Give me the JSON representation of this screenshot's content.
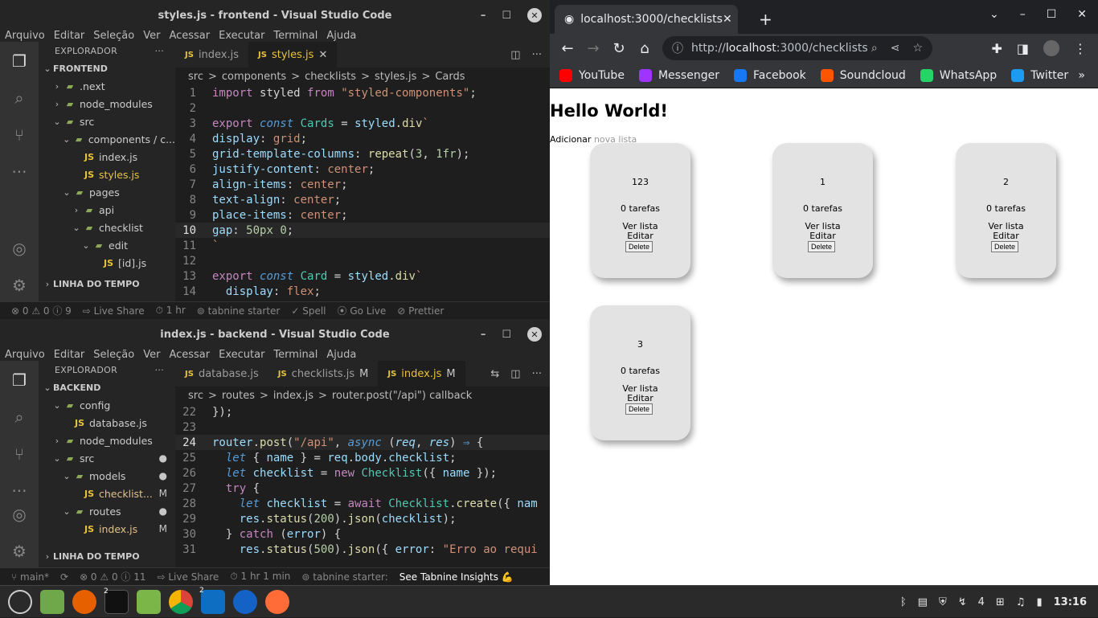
{
  "vscode_top": {
    "title": "styles.js - frontend - Visual Studio Code",
    "menu": [
      "Arquivo",
      "Editar",
      "Seleção",
      "Ver",
      "Acessar",
      "Executar",
      "Terminal",
      "Ajuda"
    ],
    "explorer_title": "EXPLORADOR",
    "tree": [
      {
        "label": "FRONTEND",
        "kind": "root"
      },
      {
        "label": ".next",
        "kind": "folder",
        "depth": 1
      },
      {
        "label": "node_modules",
        "kind": "folder",
        "depth": 1
      },
      {
        "label": "src",
        "kind": "folder-open",
        "depth": 1
      },
      {
        "label": "components / c...",
        "kind": "folder-open",
        "depth": 2
      },
      {
        "label": "index.js",
        "kind": "js",
        "depth": 3
      },
      {
        "label": "styles.js",
        "kind": "js",
        "depth": 3
      },
      {
        "label": "pages",
        "kind": "folder-open",
        "depth": 2
      },
      {
        "label": "api",
        "kind": "folder",
        "depth": 3
      },
      {
        "label": "checklist",
        "kind": "folder-open",
        "depth": 3
      },
      {
        "label": "edit",
        "kind": "folder-open",
        "depth": 4
      },
      {
        "label": "[id].js",
        "kind": "js",
        "depth": 5
      }
    ],
    "timeline": "LINHA DO TEMPO",
    "tabs": [
      {
        "label": "index.js",
        "active": false
      },
      {
        "label": "styles.js",
        "active": true
      }
    ],
    "breadcrumb": [
      "src",
      ">",
      "components",
      ">",
      "checklists",
      ">",
      "styles.js",
      ">",
      "Cards"
    ],
    "code": [
      {
        "n": "1",
        "html": "<span class='k'>import</span> <span class='pl'>styled</span> <span class='k'>from</span> <span class='s'>\"styled-components\"</span><span class='pl'>;</span>"
      },
      {
        "n": "2",
        "html": ""
      },
      {
        "n": "3",
        "html": "<span class='k'>export</span> <span class='kb it'>const</span> <span class='t'>Cards</span> <span class='pl'>=</span> <span class='v'>styled</span><span class='pl'>.</span><span class='f'>div</span><span class='s'>`</span>"
      },
      {
        "n": "4",
        "html": "<span class='v'>display</span><span class='pl'>:</span> <span class='s'>grid</span><span class='pl'>;</span>"
      },
      {
        "n": "5",
        "html": "<span class='v'>grid-template-columns</span><span class='pl'>:</span> <span class='f'>repeat</span><span class='pl'>(</span><span class='n'>3</span><span class='pl'>,</span> <span class='n'>1fr</span><span class='pl'>);</span>"
      },
      {
        "n": "6",
        "html": "<span class='v'>justify-content</span><span class='pl'>:</span> <span class='s'>center</span><span class='pl'>;</span>"
      },
      {
        "n": "7",
        "html": "<span class='v'>align-items</span><span class='pl'>:</span> <span class='s'>center</span><span class='pl'>;</span>"
      },
      {
        "n": "8",
        "html": "<span class='v'>text-align</span><span class='pl'>:</span> <span class='s'>center</span><span class='pl'>;</span>"
      },
      {
        "n": "9",
        "html": "<span class='v'>place-items</span><span class='pl'>:</span> <span class='s'>center</span><span class='pl'>;</span>"
      },
      {
        "n": "10",
        "html": "<span class='v'>gap</span><span class='pl'>:</span> <span class='n'>50px</span> <span class='n'>0</span><span class='pl'>;</span>",
        "current": true
      },
      {
        "n": "11",
        "html": "<span class='s'>`</span>"
      },
      {
        "n": "12",
        "html": ""
      },
      {
        "n": "13",
        "html": "<span class='k'>export</span> <span class='kb it'>const</span> <span class='t'>Card</span> <span class='pl'>=</span> <span class='v'>styled</span><span class='pl'>.</span><span class='f'>div</span><span class='s'>`</span>"
      },
      {
        "n": "14",
        "html": "  <span class='v'>display</span><span class='pl'>:</span> <span class='s'>flex</span><span class='pl'>;</span>"
      }
    ],
    "status": [
      "⊗ 0 ⚠ 0 ⓘ 9",
      "⇨ Live Share",
      "⏱ 1 hr",
      "⊚ tabnine starter",
      "✓ Spell",
      "⦿ Go Live",
      "⊘ Prettier"
    ]
  },
  "vscode_bottom": {
    "title": "index.js - backend - Visual Studio Code",
    "menu": [
      "Arquivo",
      "Editar",
      "Seleção",
      "Ver",
      "Acessar",
      "Executar",
      "Terminal",
      "Ajuda"
    ],
    "explorer_title": "EXPLORADOR",
    "tree": [
      {
        "label": "BACKEND",
        "kind": "root"
      },
      {
        "label": "config",
        "kind": "folder-open",
        "depth": 1
      },
      {
        "label": "database.js",
        "kind": "js",
        "depth": 2
      },
      {
        "label": "node_modules",
        "kind": "folder",
        "depth": 1
      },
      {
        "label": "src",
        "kind": "folder-open",
        "depth": 1,
        "badge": "●"
      },
      {
        "label": "models",
        "kind": "folder-open",
        "depth": 2,
        "badge": "●"
      },
      {
        "label": "checklist...",
        "kind": "js",
        "depth": 3,
        "badge": "M"
      },
      {
        "label": "routes",
        "kind": "folder-open",
        "depth": 2,
        "badge": "●"
      },
      {
        "label": "index.js",
        "kind": "js",
        "depth": 3,
        "badge": "M"
      }
    ],
    "timeline": "LINHA DO TEMPO",
    "tabs": [
      {
        "label": "database.js",
        "active": false
      },
      {
        "label": "checklists.js",
        "active": false,
        "mod": "M"
      },
      {
        "label": "index.js",
        "active": true,
        "mod": "M"
      }
    ],
    "breadcrumb": [
      "src",
      ">",
      "routes",
      ">",
      "index.js",
      ">",
      "router.post(\"/api\") callback"
    ],
    "code": [
      {
        "n": "22",
        "html": "<span class='pl'>});</span>"
      },
      {
        "n": "23",
        "html": ""
      },
      {
        "n": "24",
        "html": "<span class='v'>router</span><span class='pl'>.</span><span class='f'>post</span><span class='pl'>(</span><span class='s'>\"/api\"</span><span class='pl'>,</span> <span class='kb it'>async</span> <span class='pl'>(</span><span class='v it'>req</span><span class='pl'>,</span> <span class='v it'>res</span><span class='pl'>)</span> <span class='kb'>⇒</span> <span class='pl'>{</span>",
        "current": true
      },
      {
        "n": "25",
        "html": "  <span class='kb it'>let</span> <span class='pl'>{</span> <span class='v'>name</span> <span class='pl'>}</span> <span class='pl'>=</span> <span class='v'>req</span><span class='pl'>.</span><span class='v'>body</span><span class='pl'>.</span><span class='v'>checklist</span><span class='pl'>;</span>"
      },
      {
        "n": "26",
        "html": "  <span class='kb it'>let</span> <span class='v'>checklist</span> <span class='pl'>=</span> <span class='k'>new</span> <span class='t'>Checklist</span><span class='pl'>({</span> <span class='v'>name</span> <span class='pl'>});</span>"
      },
      {
        "n": "27",
        "html": "  <span class='k'>try</span> <span class='pl'>{</span>"
      },
      {
        "n": "28",
        "html": "    <span class='kb it'>let</span> <span class='v'>checklist</span> <span class='pl'>=</span> <span class='k'>await</span> <span class='t'>Checklist</span><span class='pl'>.</span><span class='f'>create</span><span class='pl'>({</span> <span class='v'>nam</span>"
      },
      {
        "n": "29",
        "html": "    <span class='v'>res</span><span class='pl'>.</span><span class='f'>status</span><span class='pl'>(</span><span class='n'>200</span><span class='pl'>).</span><span class='f'>json</span><span class='pl'>(</span><span class='v'>checklist</span><span class='pl'>);</span>"
      },
      {
        "n": "30",
        "html": "  <span class='pl'>}</span> <span class='k'>catch</span> <span class='pl'>(</span><span class='v'>error</span><span class='pl'>)</span> <span class='pl'>{</span>"
      },
      {
        "n": "31",
        "html": "    <span class='v'>res</span><span class='pl'>.</span><span class='f'>status</span><span class='pl'>(</span><span class='n'>500</span><span class='pl'>).</span><span class='f'>json</span><span class='pl'>({</span> <span class='v'>error</span><span class='pl'>:</span> <span class='s'>\"Erro ao requi</span>"
      }
    ],
    "status": [
      "⑂ main*",
      "⟳",
      "⊗ 0 ⚠ 0 ⓘ 11",
      "⇨ Live Share",
      "⏱ 1 hr 1 min",
      "⊚ tabnine starter:",
      "See Tabnine Insights 💪"
    ]
  },
  "browser": {
    "tab_title": "localhost:3000/checklists",
    "url_prefix": "http://",
    "url_host": "localhost",
    "url_rest": ":3000/checklists",
    "bookmarks": [
      {
        "label": "YouTube",
        "color": "#ff0000"
      },
      {
        "label": "Messenger",
        "color": "#a033ff"
      },
      {
        "label": "Facebook",
        "color": "#1877f2"
      },
      {
        "label": "Soundcloud",
        "color": "#ff5500"
      },
      {
        "label": "WhatsApp",
        "color": "#25d366"
      },
      {
        "label": "Twitter",
        "color": "#1d9bf0"
      }
    ],
    "page": {
      "heading": "Hello World!",
      "add_dark": "Adicionar",
      "add_light": " nova lista",
      "cards": [
        {
          "name": "123",
          "tasks": "0 tarefas",
          "view": "Ver lista",
          "edit": "Editar",
          "delete": "Delete"
        },
        {
          "name": "1",
          "tasks": "0 tarefas",
          "view": "Ver lista",
          "edit": "Editar",
          "delete": "Delete"
        },
        {
          "name": "2",
          "tasks": "0 tarefas",
          "view": "Ver lista",
          "edit": "Editar",
          "delete": "Delete"
        },
        {
          "name": "3",
          "tasks": "0 tarefas",
          "view": "Ver lista",
          "edit": "Editar",
          "delete": "Delete"
        }
      ]
    }
  },
  "taskbar": {
    "terminal_count": "2",
    "vscode_count": "2",
    "tray_network_count": "4",
    "clock": "13:16"
  }
}
